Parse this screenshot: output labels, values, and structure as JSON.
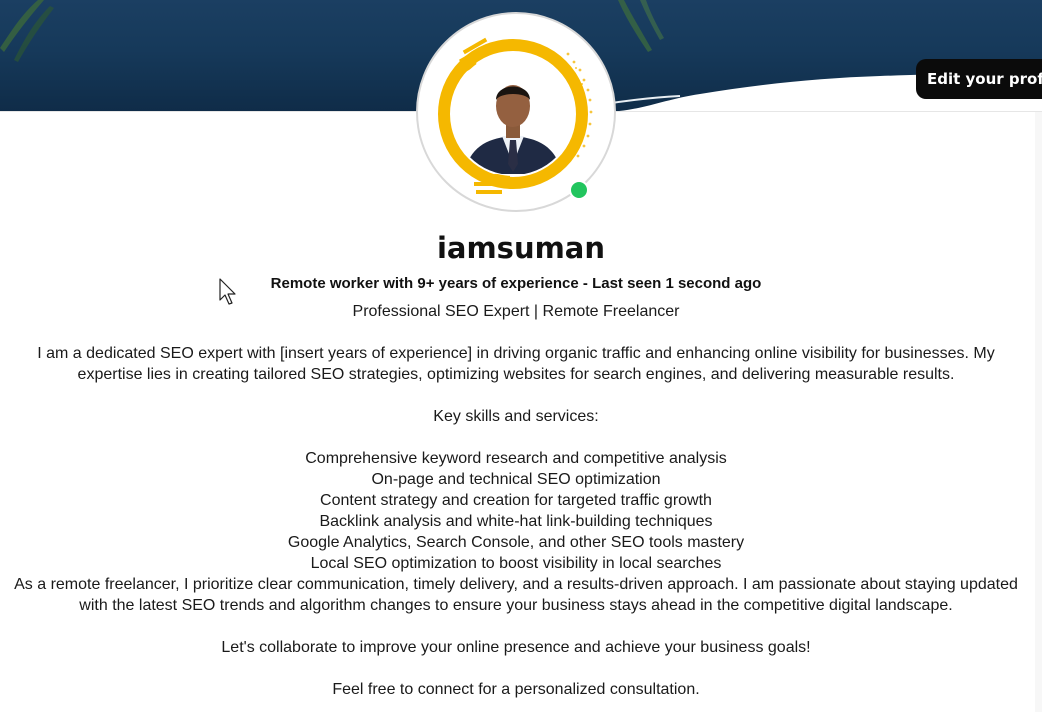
{
  "profile": {
    "edit_button_label": "Edit your profile",
    "username": "iamsuman",
    "tagline_prefix": "Remote worker with 9+ years of experience",
    "tagline_separator": " - ",
    "last_seen": "Last seen 1 second ago",
    "online_status_color": "#22c55e",
    "avatar_ring_color": "#f5b800"
  },
  "bio": {
    "headline": "Professional SEO Expert | Remote Freelancer",
    "intro": "I am a dedicated SEO expert with [insert years of experience] in driving organic traffic and enhancing online visibility for businesses. My expertise lies in creating tailored SEO strategies, optimizing websites for search engines, and delivering measurable results.",
    "skills_heading": "Key skills and services:",
    "skills": [
      "Comprehensive keyword research and competitive analysis",
      "On-page and technical SEO optimization",
      "Content strategy and creation for targeted traffic growth",
      "Backlink analysis and white-hat link-building techniques",
      "Google Analytics, Search Console, and other SEO tools mastery",
      "Local SEO optimization to boost visibility in local searches"
    ],
    "approach": "As a remote freelancer, I prioritize clear communication, timely delivery, and a results-driven approach. I am passionate about staying updated with the latest SEO trends and algorithm changes to ensure your business stays ahead in the competitive digital landscape.",
    "collaborate": "Let's collaborate to improve your online presence and achieve your business goals!",
    "closing": "Feel free to connect for a personalized consultation."
  },
  "colors": {
    "cover": "#16395a",
    "edit_button_bg": "#0b0b0b"
  }
}
